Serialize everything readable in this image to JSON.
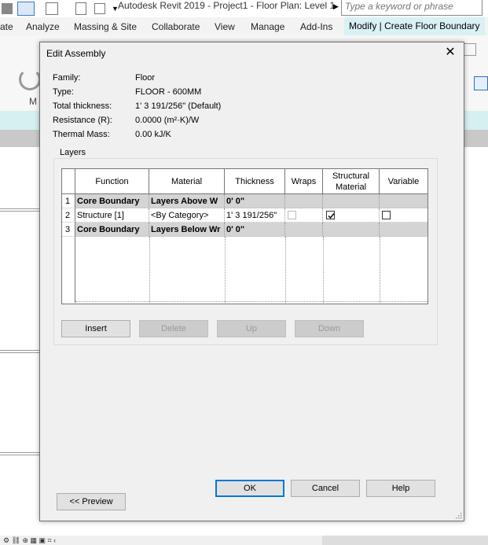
{
  "app": {
    "title": "Autodesk Revit 2019 - Project1 - Floor Plan: Level 1",
    "search_placeholder": "Type a keyword or phrase"
  },
  "ribbon": {
    "tabs": [
      "ate",
      "Analyze",
      "Massing & Site",
      "Collaborate",
      "View",
      "Manage",
      "Add-Ins",
      "Modify | Create Floor Boundary"
    ],
    "active_tab": "Modify | Create Floor Boundary",
    "partial_label": "M"
  },
  "dialog": {
    "title": "Edit Assembly",
    "properties": {
      "family_label": "Family:",
      "family_value": "Floor",
      "type_label": "Type:",
      "type_value": "FLOOR - 600MM",
      "thickness_label": "Total thickness:",
      "thickness_value": "1'  3 191/256\" (Default)",
      "resistance_label": "Resistance (R):",
      "resistance_value": "0.0000 (m²·K)/W",
      "mass_label": "Thermal Mass:",
      "mass_value": "0.00 kJ/K"
    },
    "layers_label": "Layers",
    "columns": {
      "function": "Function",
      "material": "Material",
      "thickness": "Thickness",
      "wraps": "Wraps",
      "structural_material": "Structural Material",
      "variable": "Variable"
    },
    "rows": [
      {
        "num": "1",
        "function": "Core Boundary",
        "material": "Layers Above W",
        "thickness": "0'  0\""
      },
      {
        "num": "2",
        "function": "Structure [1]",
        "material": "<By Category>",
        "thickness": "1'  3 191/256\""
      },
      {
        "num": "3",
        "function": "Core Boundary",
        "material": "Layers Below Wr",
        "thickness": "0'  0\""
      }
    ],
    "row2_structural_checked": true,
    "row2_variable_checked": false,
    "buttons": {
      "insert": "Insert",
      "delete": "Delete",
      "up": "Up",
      "down": "Down",
      "ok": "OK",
      "cancel": "Cancel",
      "help": "Help",
      "preview": "<< Preview"
    }
  }
}
